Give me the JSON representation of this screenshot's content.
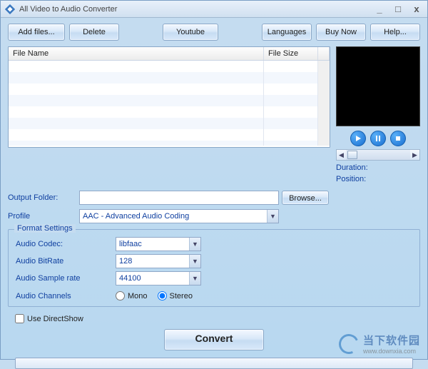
{
  "window": {
    "title": "All Video to Audio Converter"
  },
  "toolbar": {
    "add": "Add files...",
    "delete": "Delete",
    "youtube": "Youtube",
    "languages": "Languages",
    "buy": "Buy Now",
    "help": "Help..."
  },
  "filelist": {
    "col_name": "File Name",
    "col_size": "File Size"
  },
  "preview": {
    "duration_label": "Duration:",
    "position_label": "Position:"
  },
  "form": {
    "output_folder_label": "Output Folder:",
    "output_folder_value": "",
    "browse": "Browse...",
    "profile_label": "Profile",
    "profile_value": "AAC - Advanced Audio Coding"
  },
  "format": {
    "legend": "Format Settings",
    "codec_label": "Audio Codec:",
    "codec_value": "libfaac",
    "bitrate_label": "Audio BitRate",
    "bitrate_value": "128",
    "sample_label": "Audio Sample rate",
    "sample_value": "44100",
    "channels_label": "Audio Channels",
    "mono": "Mono",
    "stereo": "Stereo",
    "selected_channel": "stereo"
  },
  "directshow": {
    "label": "Use DirectShow",
    "checked": false
  },
  "convert_label": "Convert",
  "watermark": {
    "big": "当下软件园",
    "small": "www.downxia.com"
  }
}
